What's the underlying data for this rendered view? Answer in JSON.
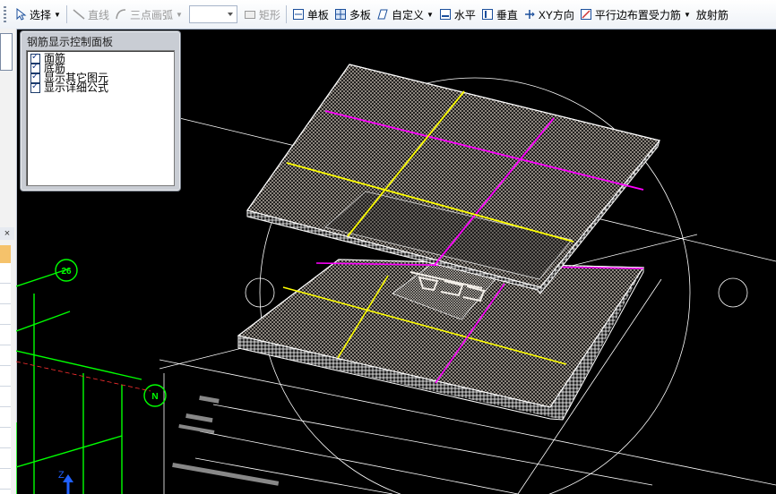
{
  "toolbar": {
    "select": "选择",
    "line": "直线",
    "arc3": "三点画弧",
    "combo_value": "",
    "rect": "矩形",
    "single_slab": "单板",
    "multi_slab": "多板",
    "custom": "自定义",
    "horizontal": "水平",
    "vertical": "垂直",
    "xy_dir": "XY方向",
    "parallel_edge": "平行边布置受力筋",
    "radial": "放射筋"
  },
  "panel": {
    "title": "钢筋显示控制面板",
    "items": [
      {
        "label": "面筋",
        "checked": true
      },
      {
        "label": "底筋",
        "checked": true
      },
      {
        "label": "显示其它图元",
        "checked": true
      },
      {
        "label": "显示详细公式",
        "checked": true
      }
    ]
  },
  "viewport": {
    "axis_26": "26",
    "axis_n": "N",
    "axis_z": "Z"
  },
  "colors": {
    "top_bar_1": "#ffff00",
    "top_bar_2": "#ff00ff",
    "axis_green": "#00ff00",
    "slab_white": "#ffffff"
  }
}
